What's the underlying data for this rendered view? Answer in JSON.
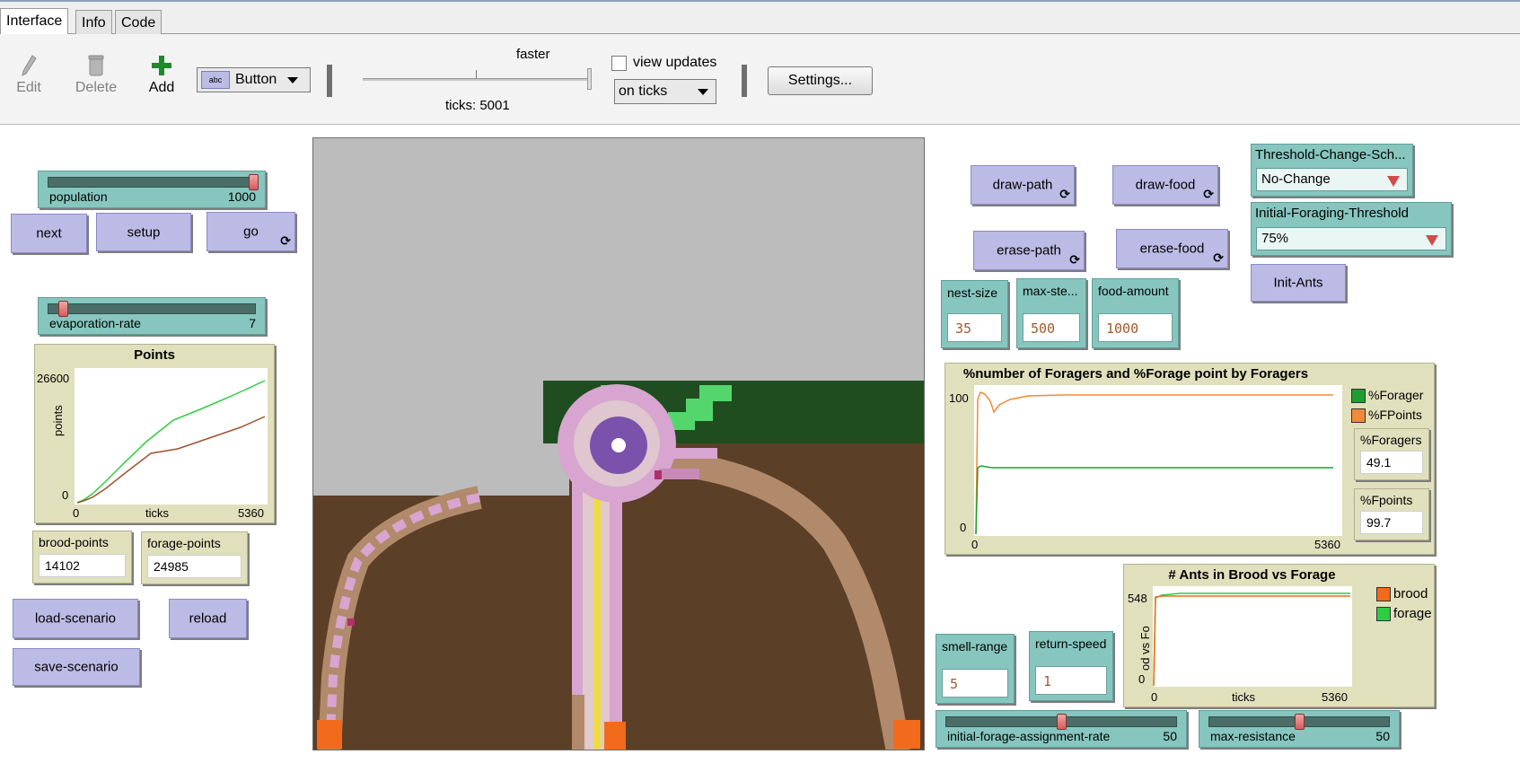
{
  "tabs": [
    {
      "label": "Interface"
    },
    {
      "label": "Info"
    },
    {
      "label": "Code"
    }
  ],
  "toolbar": {
    "edit_label": "Edit",
    "delete_label": "Delete",
    "add_label": "Add",
    "widget_type": "Button",
    "speed_label": "faster",
    "ticks_text": "ticks: 5001",
    "view_updates_label": "view updates",
    "update_mode": "on ticks",
    "settings_label": "Settings..."
  },
  "left_panel": {
    "population": {
      "name": "population",
      "value": "1000",
      "fraction": 1.0
    },
    "next_label": "next",
    "setup_label": "setup",
    "go_label": "go",
    "evaporation": {
      "name": "evaporation-rate",
      "value": "7",
      "fraction": 0.07
    },
    "points_plot": {
      "title": "Points",
      "ymax": "26600",
      "ymin": "0",
      "ylabel": "points",
      "xmin": "0",
      "xlabel": "ticks",
      "xmax": "5360"
    },
    "brood_points": {
      "name": "brood-points",
      "value": "14102"
    },
    "forage_points": {
      "name": "forage-points",
      "value": "24985"
    },
    "load_label": "load-scenario",
    "reload_label": "reload",
    "save_label": "save-scenario"
  },
  "right_panel": {
    "draw_path_label": "draw-path",
    "draw_food_label": "draw-food",
    "erase_path_label": "erase-path",
    "erase_food_label": "erase-food",
    "threshold_chooser": {
      "name": "Threshold-Change-Sch...",
      "value": "No-Change"
    },
    "initial_threshold_chooser": {
      "name": "Initial-Foraging-Threshold",
      "value": "75%"
    },
    "init_ants_label": "Init-Ants",
    "nest_size": {
      "name": "nest-size",
      "value": "35"
    },
    "max_steps": {
      "name": "max-ste...",
      "value": "500"
    },
    "food_amount": {
      "name": "food-amount",
      "value": "1000"
    },
    "foragers_plot": {
      "title": "%number of Foragers and %Forage point by Foragers",
      "ymax": "100",
      "ymin": "0",
      "xmin": "0",
      "xmax": "5360",
      "legend": [
        {
          "name": "%Forager",
          "color": "#1e9e32"
        },
        {
          "name": "%FPoints",
          "color": "#f08a3c"
        }
      ]
    },
    "pct_foragers": {
      "name": "%Foragers",
      "value": "49.1"
    },
    "pct_fpoints": {
      "name": "%Fpoints",
      "value": "99.7"
    },
    "ants_plot": {
      "title": "# Ants in Brood vs Forage",
      "ymax": "548",
      "ymin": "0",
      "ylabel": "od vs Fo",
      "xmin": "0",
      "xlabel": "ticks",
      "xmax": "5360",
      "legend": [
        {
          "name": "brood",
          "color": "#f26a1b"
        },
        {
          "name": "forage",
          "color": "#2ecc40"
        }
      ]
    },
    "smell_range": {
      "name": "smell-range",
      "value": "5"
    },
    "return_speed": {
      "name": "return-speed",
      "value": "1"
    },
    "initial_forage_rate": {
      "name": "initial-forage-assignment-rate",
      "value": "50",
      "fraction": 0.5
    },
    "max_resistance": {
      "name": "max-resistance",
      "value": "50",
      "fraction": 0.5
    }
  },
  "colors": {
    "button": "#bcbbe6",
    "slider": "#86c6bf",
    "monitor": "#e1e0bd",
    "soil": "#5c3f27",
    "nest": "#7a52ab",
    "pheromone": "#d7a5cf",
    "food": "#f26a1b",
    "grass": "#1f4d1f"
  }
}
